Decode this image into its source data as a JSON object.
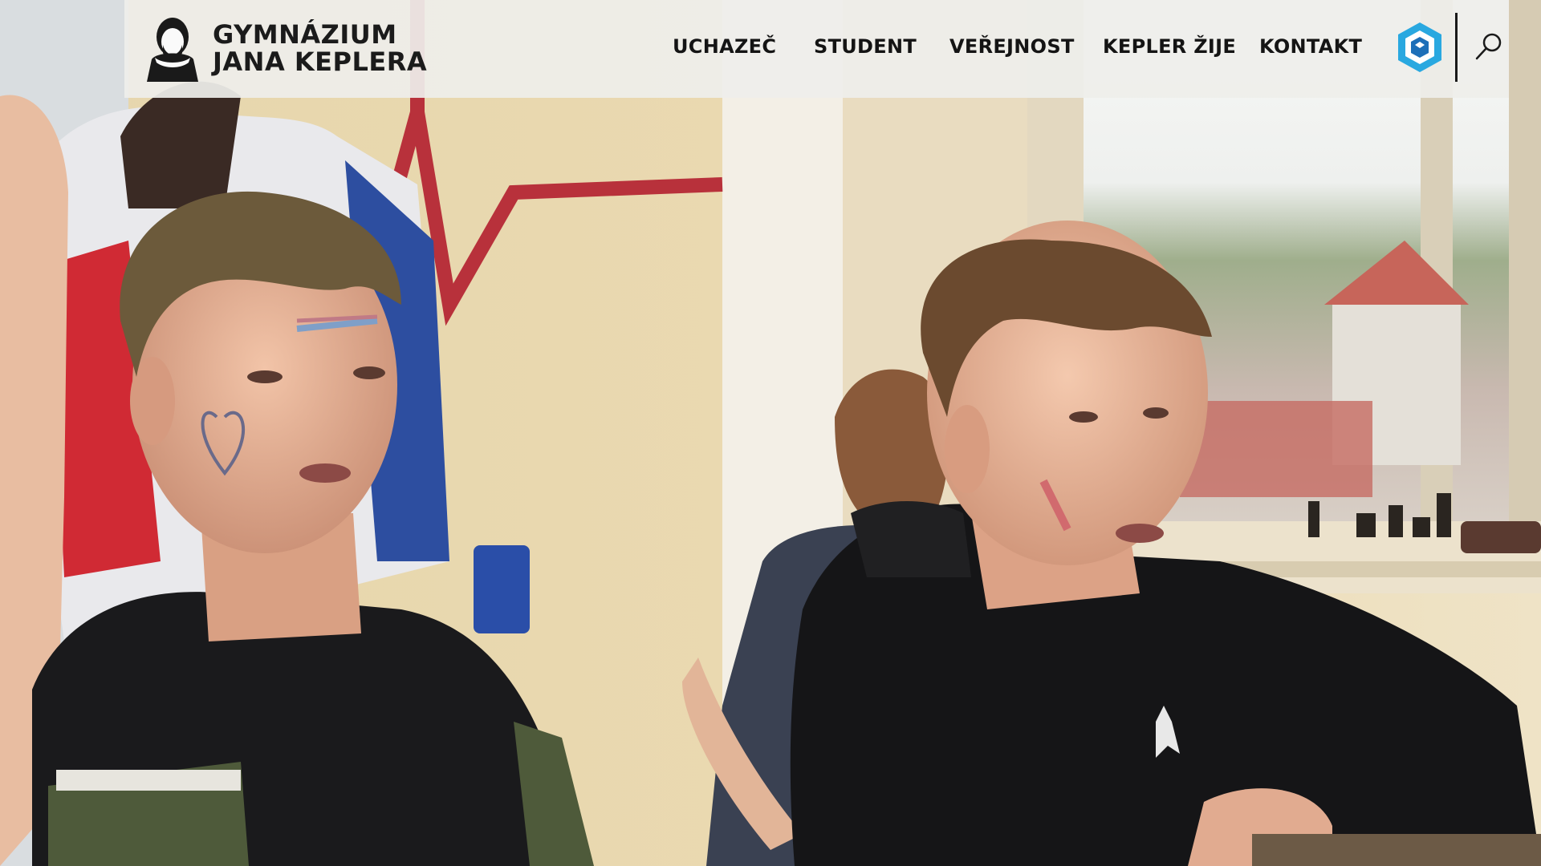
{
  "site": {
    "logo_line1": "GYMNÁZIUM",
    "logo_line2": "JANA KEPLERA"
  },
  "nav": {
    "items": [
      {
        "label": "UCHAZEČ"
      },
      {
        "label": "STUDENT"
      },
      {
        "label": "VEŘEJNOST"
      },
      {
        "label": "KEPLER ŽIJE"
      },
      {
        "label": "KONTAKT"
      }
    ]
  },
  "icons": {
    "brand": "hexagon-logo-icon",
    "search": "search-icon"
  },
  "colors": {
    "nav_bg": "#eeeeeb",
    "nav_text": "#141414",
    "brand_blue": "#29a8e0"
  }
}
